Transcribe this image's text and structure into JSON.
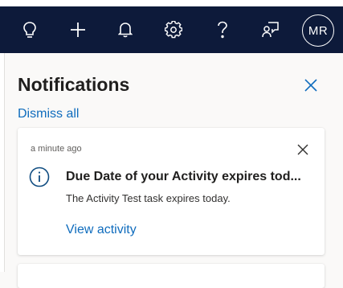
{
  "header": {
    "icons": [
      "lightbulb-icon",
      "plus-icon",
      "bell-icon",
      "gear-icon",
      "help-icon",
      "feedback-icon"
    ],
    "avatar_initials": "MR"
  },
  "panel": {
    "title": "Notifications",
    "dismiss_all": "Dismiss all"
  },
  "notifications": [
    {
      "timestamp": "a minute ago",
      "title": "Due Date of your Activity expires tod...",
      "body": "The Activity Test task expires today.",
      "action": "View activity"
    }
  ],
  "colors": {
    "header_bg": "#0d1a3a",
    "accent": "#0f6cbd",
    "panel_bg": "#faf9f8"
  }
}
